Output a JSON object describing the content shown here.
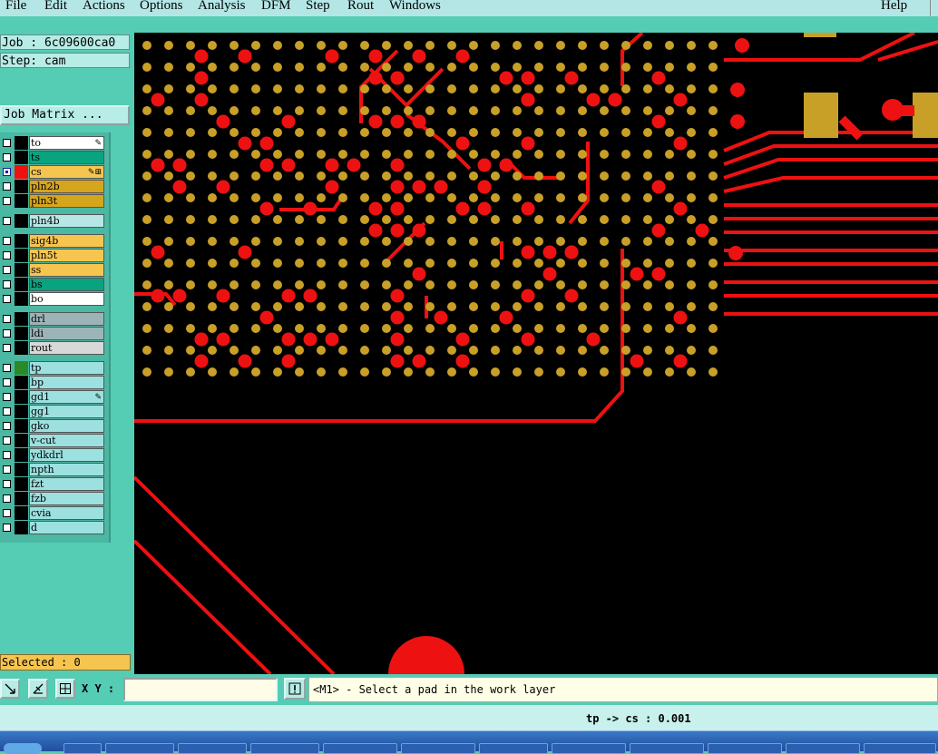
{
  "menu": {
    "items": [
      "File",
      "Edit",
      "Actions",
      "Options",
      "Analysis",
      "DFM",
      "Step",
      "Rout",
      "Windows"
    ],
    "help": "Help"
  },
  "job": {
    "label": "Job : 6c09600ca0",
    "step": "Step: cam",
    "matrix_button": "Job Matrix ..."
  },
  "layers": [
    {
      "name": "to",
      "color": "#ffffff",
      "mark": "✎",
      "swatch": "#000000",
      "checked": false
    },
    {
      "name": "ts",
      "color": "#0aa37f",
      "mark": "",
      "swatch": "#000000",
      "checked": false
    },
    {
      "name": "cs",
      "color": "#f6c550",
      "mark": "✎⊞",
      "swatch": "#ee1111",
      "checked": true
    },
    {
      "name": "pln2b",
      "color": "#d6a51e",
      "mark": "",
      "swatch": "#000000",
      "checked": false
    },
    {
      "name": "pln3t",
      "color": "#d6a51e",
      "mark": "",
      "swatch": "#000000",
      "checked": false
    },
    {
      "name": "pln4b",
      "color": "#b8e6e6",
      "mark": "",
      "swatch": "#000000",
      "checked": false
    },
    {
      "name": "sig4b",
      "color": "#f6c550",
      "mark": "",
      "swatch": "#000000",
      "checked": false
    },
    {
      "name": "pln5t",
      "color": "#f6c550",
      "mark": "",
      "swatch": "#000000",
      "checked": false
    },
    {
      "name": "ss",
      "color": "#f6c550",
      "mark": "",
      "swatch": "#000000",
      "checked": false
    },
    {
      "name": "bs",
      "color": "#0aa37f",
      "mark": "",
      "swatch": "#000000",
      "checked": false
    },
    {
      "name": "bo",
      "color": "#ffffff",
      "mark": "",
      "swatch": "#000000",
      "checked": false
    },
    {
      "name": "drl",
      "color": "#9cb4b8",
      "mark": "",
      "swatch": "#000000",
      "checked": false
    },
    {
      "name": "ldi",
      "color": "#9cb4b8",
      "mark": "",
      "swatch": "#000000",
      "checked": false
    },
    {
      "name": "rout",
      "color": "#d8d8d8",
      "mark": "",
      "swatch": "#000000",
      "checked": false
    },
    {
      "name": "tp",
      "color": "#9ce0e0",
      "mark": "",
      "swatch": "#2a8a2a",
      "checked": false
    },
    {
      "name": "bp",
      "color": "#9ce0e0",
      "mark": "",
      "swatch": "#000000",
      "checked": false
    },
    {
      "name": "gd1",
      "color": "#9ce0e0",
      "mark": "✎",
      "swatch": "#000000",
      "checked": false
    },
    {
      "name": "gg1",
      "color": "#9ce0e0",
      "mark": "",
      "swatch": "#000000",
      "checked": false
    },
    {
      "name": "gko",
      "color": "#9ce0e0",
      "mark": "",
      "swatch": "#000000",
      "checked": false
    },
    {
      "name": "v-cut",
      "color": "#9ce0e0",
      "mark": "",
      "swatch": "#000000",
      "checked": false
    },
    {
      "name": "ydkdrl",
      "color": "#9ce0e0",
      "mark": "",
      "swatch": "#000000",
      "checked": false
    },
    {
      "name": "npth",
      "color": "#9ce0e0",
      "mark": "",
      "swatch": "#000000",
      "checked": false
    },
    {
      "name": "fzt",
      "color": "#9ce0e0",
      "mark": "",
      "swatch": "#000000",
      "checked": false
    },
    {
      "name": "fzb",
      "color": "#9ce0e0",
      "mark": "",
      "swatch": "#000000",
      "checked": false
    },
    {
      "name": "cvia",
      "color": "#9ce0e0",
      "mark": "",
      "swatch": "#000000",
      "checked": false
    },
    {
      "name": "d",
      "color": "#9ce0e0",
      "mark": "",
      "swatch": "#000000",
      "checked": false
    }
  ],
  "selected": "Selected : 0",
  "toolbar": {
    "xy_label": "X Y :",
    "xy_value": "",
    "message": "<M1> - Select a pad in the work layer"
  },
  "status": "tp -> cs : 0.001",
  "colors": {
    "copper": "#ee1111",
    "pad": "#c8a028",
    "canvas": "#000000"
  }
}
